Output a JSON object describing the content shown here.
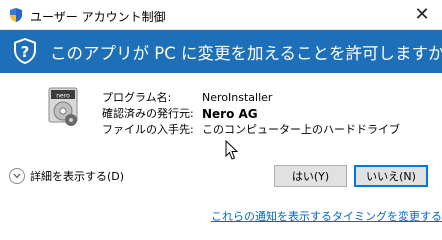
{
  "window": {
    "title": "ユーザー アカウント制御",
    "close_icon": "close-icon"
  },
  "banner": {
    "icon": "uac-shield-question-icon",
    "question": "このアプリが PC に変更を加えることを許可しますか?",
    "background": "#1d6fb8"
  },
  "app": {
    "icon": "nero-installer-icon",
    "fields": [
      {
        "label": "プログラム名:",
        "value": "NeroInstaller"
      },
      {
        "label": "確認済みの発行元:",
        "value": "Nero AG"
      },
      {
        "label": "ファイルの入手先:",
        "value": "このコンピューター上のハードドライブ"
      }
    ]
  },
  "details": {
    "icon": "chevron-down-icon",
    "label": "詳細を表示する(D)"
  },
  "buttons": {
    "yes": "はい(Y)",
    "no": "いいえ(N)"
  },
  "link": {
    "text": "これらの通知を表示するタイミングを変更する"
  }
}
